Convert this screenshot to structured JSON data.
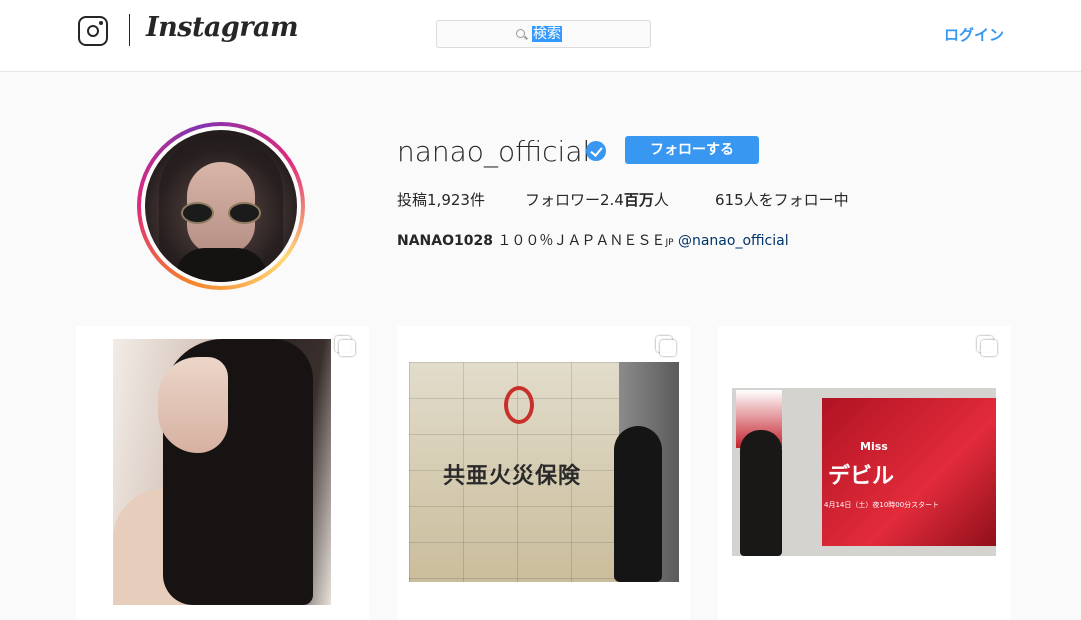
{
  "nav": {
    "brand": "Instagram",
    "search": {
      "placeholder": "検索"
    },
    "login_label": "ログイン"
  },
  "profile": {
    "username": "nanao_official",
    "verified": true,
    "follow_label": "フォローする",
    "stats": {
      "posts_prefix": "投稿",
      "posts_count": "1,923",
      "posts_suffix": "件",
      "followers_prefix": "フォロワー",
      "followers_count": "2.4",
      "followers_unit": "百万",
      "followers_suffix": "人",
      "following_count": "615",
      "following_suffix": "人をフォロー中"
    },
    "bio": {
      "name": "NANAO1028",
      "text": " １００％ＪＡＰＡＮＥＳＥ",
      "small": "JP",
      "handle": " @nanao_official"
    }
  },
  "posts": [
    {
      "id": "post-1",
      "multi": true
    },
    {
      "id": "post-2",
      "multi": true,
      "sign_text": "共亜火災保険"
    },
    {
      "id": "post-3",
      "multi": true,
      "poster_miss": "Miss",
      "poster_title": "デビル",
      "poster_date": "4月14日（土）夜10時00分スタート"
    }
  ],
  "colors": {
    "accent": "#3897f0",
    "text": "#262626",
    "background": "#fafafa"
  },
  "icons": [
    "instagram-glyph-icon",
    "search-icon",
    "verified-badge-icon",
    "multi-photo-icon"
  ]
}
